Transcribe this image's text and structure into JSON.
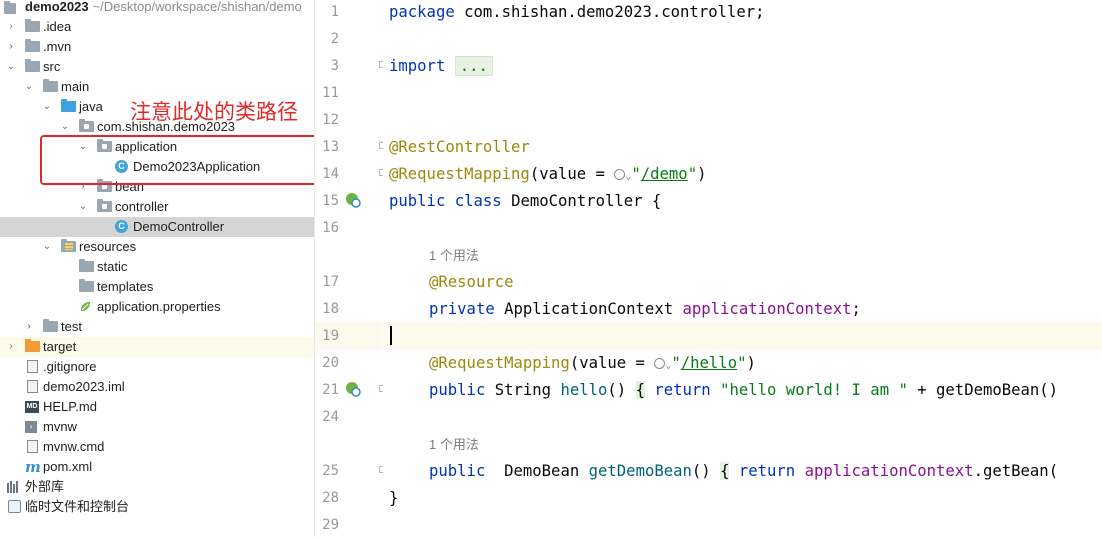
{
  "project_tree": {
    "root": {
      "name": "demo2023",
      "path": "~/Desktop/workspace/shishan/demo"
    },
    "items": [
      {
        "label": ".idea"
      },
      {
        "label": ".mvn"
      },
      {
        "label": "src"
      },
      {
        "label": "main"
      },
      {
        "label": "java"
      },
      {
        "label": "com.shishan.demo2023"
      },
      {
        "label": "application"
      },
      {
        "label": "Demo2023Application"
      },
      {
        "label": "bean"
      },
      {
        "label": "controller"
      },
      {
        "label": "DemoController"
      },
      {
        "label": "resources"
      },
      {
        "label": "static"
      },
      {
        "label": "templates"
      },
      {
        "label": "application.properties"
      },
      {
        "label": "test"
      },
      {
        "label": "target"
      },
      {
        "label": ".gitignore"
      },
      {
        "label": "demo2023.iml"
      },
      {
        "label": "HELP.md"
      },
      {
        "label": "mvnw"
      },
      {
        "label": "mvnw.cmd"
      },
      {
        "label": "pom.xml"
      },
      {
        "label": "外部库"
      },
      {
        "label": "临时文件和控制台"
      }
    ],
    "class_badge": "C",
    "md_badge": "MD",
    "pom_badge": "m"
  },
  "annotation": {
    "text": "注意此处的类路径",
    "color": "#e02a2a"
  },
  "editor": {
    "line_numbers": [
      "1",
      "2",
      "3",
      "11",
      "12",
      "13",
      "14",
      "15",
      "16",
      "17",
      "18",
      "19",
      "20",
      "21",
      "24",
      "25",
      "28",
      "29"
    ],
    "code": {
      "l1_kw": "package",
      "l1_rest": " com.shishan.demo2023.controller;",
      "l3_kw": "import",
      "l3_collapsed": "...",
      "l13": "@RestController",
      "l14_ann": "@RequestMapping",
      "l14_a": "(value = ",
      "l14_q1": "\"",
      "l14_url": "/demo",
      "l14_q2": "\"",
      "l14_b": ")",
      "l15_kw1": "public",
      "l15_kw2": "class",
      "l15_rest": " DemoController {",
      "hint_usage": "1 个用法",
      "l17": "@Resource",
      "l18_kw": "private",
      "l18_type": " ApplicationContext ",
      "l18_field": "applicationContext",
      "l18_end": ";",
      "l20_ann": "@RequestMapping",
      "l20_a": "(value = ",
      "l20_q1": "\"",
      "l20_url": "/hello",
      "l20_q2": "\"",
      "l20_b": ")",
      "l21_kw": "public",
      "l21_type": " String ",
      "l21_method": "hello",
      "l21_paren": "() ",
      "l21_brace": "{",
      "l21_ret": "return",
      "l21_str": "\"hello world! I am \"",
      "l21_rest": " + getDemoBean()",
      "l25_kw": "public",
      "l25_type": "  DemoBean ",
      "l25_method": "getDemoBean",
      "l25_paren": "() ",
      "l25_brace": "{",
      "l25_ret": "return",
      "l25_field": "applicationContext",
      "l25_rest": ".getBean(",
      "l28": "}"
    },
    "colors": {
      "keyword": "#0033b3",
      "annotation": "#9e880d",
      "string": "#067d17",
      "field": "#871094",
      "method": "#00627a"
    }
  }
}
